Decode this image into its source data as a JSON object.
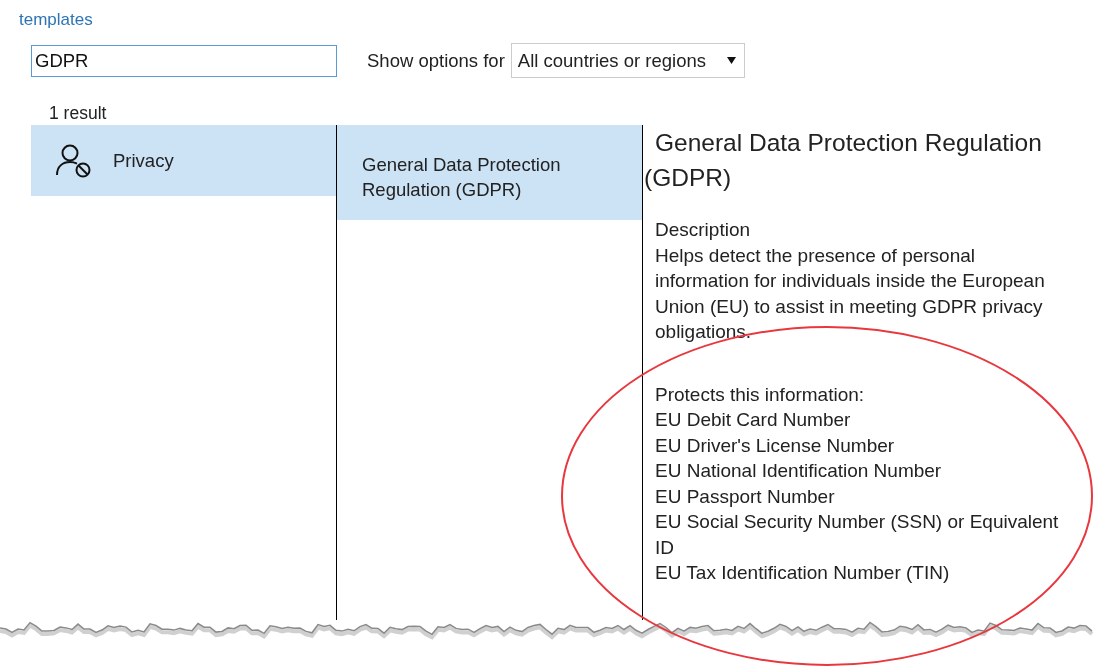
{
  "header_link": "templates",
  "search": {
    "value": "GDPR"
  },
  "filter": {
    "label": "Show options for",
    "value": "All countries or regions"
  },
  "result_count": "1 result",
  "categories": [
    {
      "label": "Privacy",
      "selected": true
    }
  ],
  "templates": [
    {
      "label": "General Data Protection Regulation (GDPR)",
      "selected": true
    }
  ],
  "details": {
    "title": "General Data Protection Regulation (GDPR)",
    "description_label": "Description",
    "description": "Helps detect the presence of personal information for individuals inside the European Union (EU) to assist in meeting GDPR privacy obligations.",
    "protects_label": "Protects this information:",
    "protected_info": [
      "EU Debit Card Number",
      "EU Driver's License Number",
      "EU National Identification Number",
      "EU Passport Number",
      "EU Social Security Number (SSN) or Equivalent ID",
      "EU Tax Identification Number (TIN)"
    ]
  }
}
